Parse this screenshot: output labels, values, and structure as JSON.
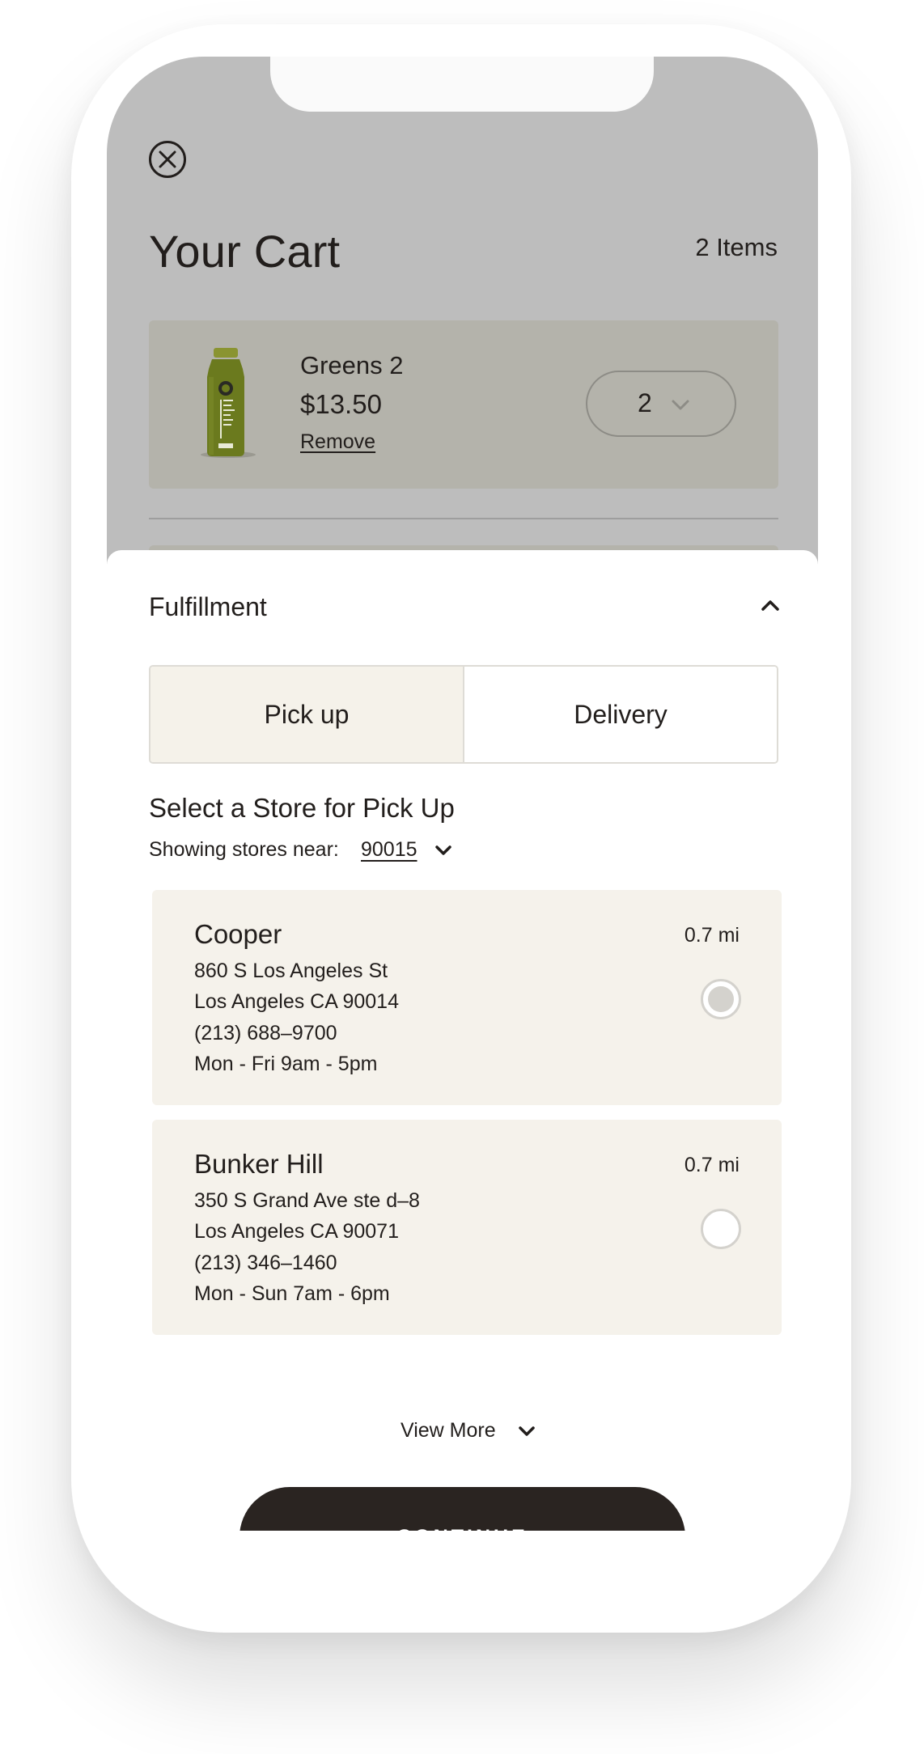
{
  "cart": {
    "title": "Your Cart",
    "item_count": "2 Items",
    "items": [
      {
        "name": "Greens 2",
        "price": "$13.50",
        "remove_label": "Remove",
        "quantity": "2"
      }
    ]
  },
  "fulfillment": {
    "title": "Fulfillment",
    "tabs": [
      {
        "label": "Pick up",
        "active": true
      },
      {
        "label": "Delivery",
        "active": false
      }
    ],
    "store_heading": "Select a Store for Pick Up",
    "near_label": "Showing stores near:",
    "near_zip": "90015",
    "stores": [
      {
        "name": "Cooper",
        "distance": "0.7 mi",
        "address1": "860 S Los Angeles St",
        "address2": "Los Angeles CA 90014",
        "phone": "(213) 688–9700",
        "hours": "Mon - Fri 9am - 5pm",
        "selected": true
      },
      {
        "name": "Bunker Hill",
        "distance": "0.7 mi",
        "address1": "350 S Grand Ave ste d–8",
        "address2": "Los Angeles CA 90071",
        "phone": "(213) 346–1460",
        "hours": "Mon - Sun 7am - 6pm",
        "selected": false
      }
    ],
    "view_more_label": "View More",
    "continue_label": "CONTINUE"
  },
  "icons": {
    "close": "close-icon",
    "quantity_dropdown": "chevron-down-icon",
    "collapse": "chevron-up-icon",
    "zip_dropdown": "chevron-down-icon",
    "view_more": "chevron-down-icon"
  },
  "colors": {
    "dark": "#2a2421",
    "overlay_gray": "#bdbdbd",
    "card_beige": "#f5f2eb",
    "product_green": "#6b7a1e"
  }
}
